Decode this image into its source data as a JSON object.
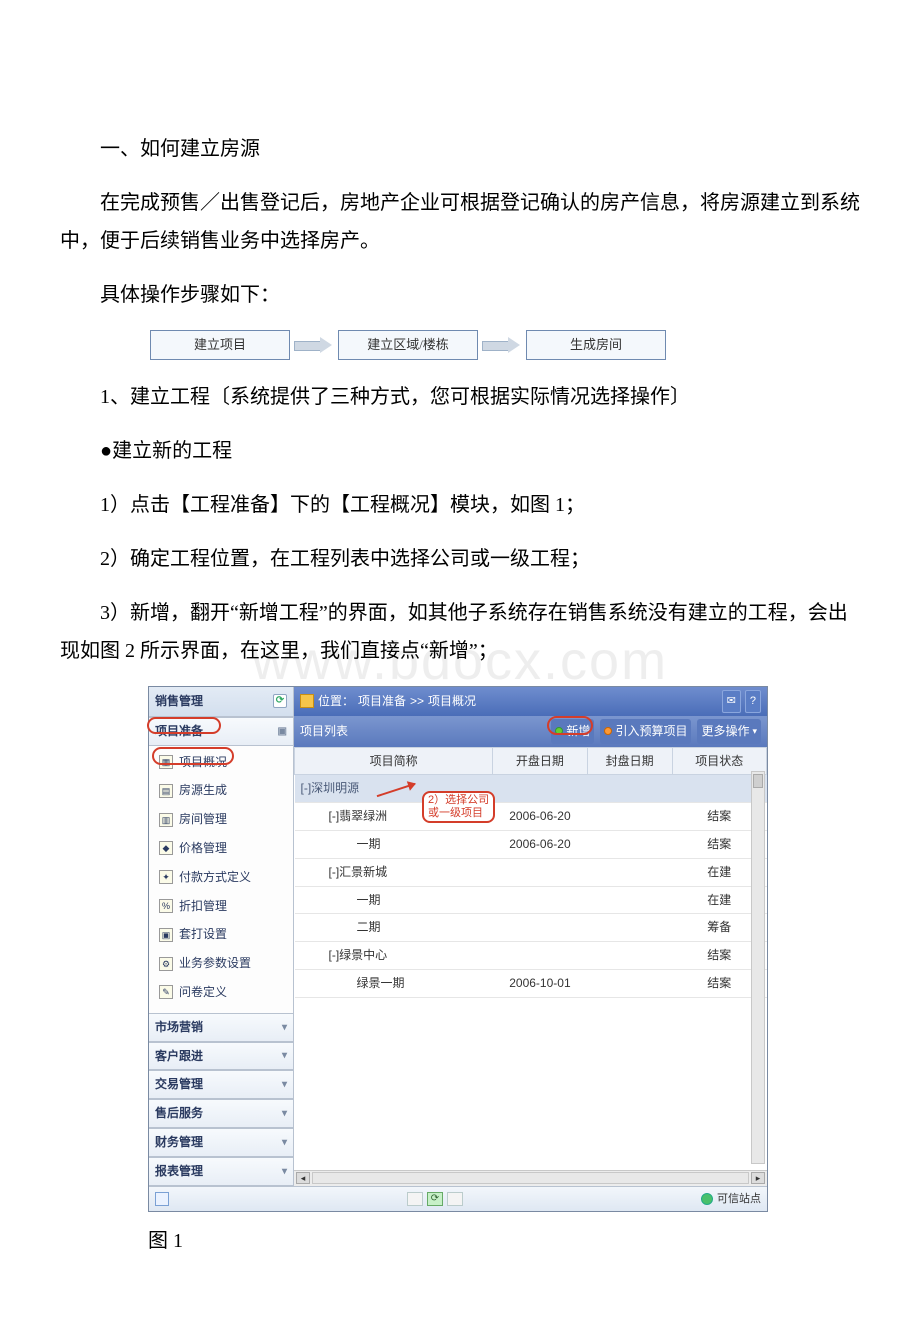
{
  "watermark": "www.bdocx.com",
  "heading1": "一、如何建立房源",
  "para1": "在完成预售／出售登记后，房地产企业可根据登记确认的房产信息，将房源建立到系统中，便于后续销售业务中选择房产。",
  "para2": "具体操作步骤如下：",
  "flow": {
    "box1": "建立项目",
    "box2": "建立区域/楼栋",
    "box3": "生成房间"
  },
  "para3": "1、建立工程〔系统提供了三种方式，您可根据实际情况选择操作〕",
  "para4": "●建立新的工程",
  "para5": "1）点击【工程准备】下的【工程概况】模块，如图 1；",
  "para6": "2）确定工程位置，在工程列表中选择公司或一级工程；",
  "para7": "3）新增，翻开“新增工程”的界面，如其他子系统存在销售系统没有建立的工程，会出现如图 2 所示界面，在这里，我们直接点“新增”；",
  "fig1_label": "图 1",
  "screenshot": {
    "left_panel": {
      "title": "销售管理",
      "sections": [
        {
          "label": "项目准备",
          "expanded": true,
          "ringed": true
        },
        {
          "label": "市场营销",
          "expanded": false
        },
        {
          "label": "客户跟进",
          "expanded": false
        },
        {
          "label": "交易管理",
          "expanded": false
        },
        {
          "label": "售后服务",
          "expanded": false
        },
        {
          "label": "财务管理",
          "expanded": false
        },
        {
          "label": "报表管理",
          "expanded": false
        }
      ],
      "items": [
        {
          "label": "项目概况",
          "ringed": true
        },
        {
          "label": "房源生成"
        },
        {
          "label": "房间管理"
        },
        {
          "label": "价格管理"
        },
        {
          "label": "付款方式定义"
        },
        {
          "label": "折扣管理"
        },
        {
          "label": "套打设置"
        },
        {
          "label": "业务参数设置"
        },
        {
          "label": "问卷定义"
        }
      ]
    },
    "loc_bar": {
      "prefix": "位置：",
      "path1": "项目准备",
      "sep": " >> ",
      "path2": "项目概况"
    },
    "list_header": {
      "title": "项目列表",
      "btn_new": "新增",
      "btn_import": "引入预算项目",
      "btn_more": "更多操作",
      "btn_new_ringed": true
    },
    "table": {
      "columns": [
        "项目简称",
        "开盘日期",
        "封盘日期",
        "项目状态"
      ],
      "group_label": "[-]深圳明源",
      "rows": [
        {
          "name": "[-]翡翠绿洲",
          "indent": 1,
          "open": "2006-06-20",
          "close": "",
          "status": "结案"
        },
        {
          "name": "一期",
          "indent": 2,
          "open": "2006-06-20",
          "close": "",
          "status": "结案"
        },
        {
          "name": "[-]汇景新城",
          "indent": 1,
          "open": "",
          "close": "",
          "status": "在建"
        },
        {
          "name": "一期",
          "indent": 2,
          "open": "",
          "close": "",
          "status": "在建"
        },
        {
          "name": "二期",
          "indent": 2,
          "open": "",
          "close": "",
          "status": "筹备"
        },
        {
          "name": "[-]绿景中心",
          "indent": 1,
          "open": "",
          "close": "",
          "status": "结案"
        },
        {
          "name": "绿景一期",
          "indent": 2,
          "open": "2006-10-01",
          "close": "",
          "status": "结案"
        }
      ]
    },
    "callout": {
      "text_line1": "2）选择公司",
      "text_line2": "或一级项目"
    },
    "status_bar": {
      "trusted": "可信站点"
    }
  }
}
